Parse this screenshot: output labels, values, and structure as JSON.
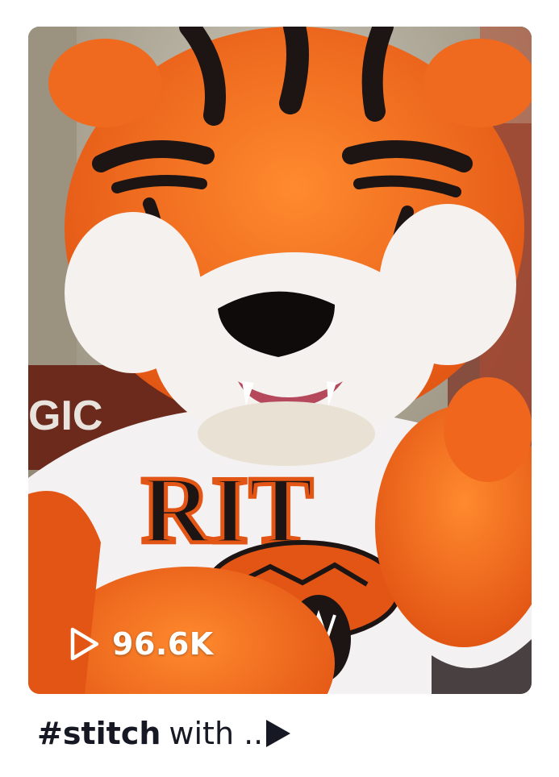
{
  "video": {
    "view_count": "96.6K",
    "caption_hashtag": "#stitch",
    "caption_rest": "with ..",
    "thumbnail_subject": "orange tiger mascot with white RIT jersey",
    "thumbnail_text": [
      "GIC",
      "RIT"
    ],
    "icons": {
      "views": "play-outline-icon",
      "more": "play-triangle-icon"
    }
  },
  "colors": {
    "fur_orange": "#f26b1d",
    "stripe_black": "#1d1414",
    "jersey_white": "#f3f1f2",
    "text_dark": "#161823"
  }
}
